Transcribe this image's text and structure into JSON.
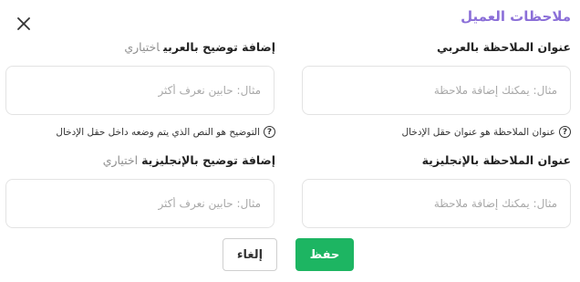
{
  "dialog": {
    "title": "ملاحظات العميل",
    "close_icon": "close-icon"
  },
  "fields": {
    "arabic_title": {
      "label": "عنوان الملاحظة بالعربي",
      "placeholder": "مثال: يمكنك إضافة ملاحظة",
      "value": ""
    },
    "arabic_description": {
      "label": "إضافة توضيح بالعربي",
      "optional": "اختياري",
      "placeholder": "مثال: حابين نعرف أكثر",
      "value": ""
    },
    "english_title": {
      "label": "عنوان الملاحظة بالإنجليزية",
      "placeholder": "مثال: يمكنك إضافة ملاحظة",
      "value": ""
    },
    "english_description": {
      "label": "إضافة توضيح بالإنجليزية",
      "optional": "اختياري",
      "placeholder": "مثال: حابين نعرف أكثر",
      "value": ""
    }
  },
  "hints": {
    "title_hint": "عنوان الملاحظة هو عنوان حقل الإدخال",
    "description_hint": "التوضيح هو النص الذي يتم وضعه داخل حقل الإدخال",
    "hint_icon_symbol": "?",
    "hint_icon": "question-circle-icon"
  },
  "actions": {
    "save_label": "حفظ",
    "cancel_label": "إلغاء"
  },
  "colors": {
    "title": "#8b6fd8",
    "save_button": "#1db562",
    "border": "#e3e3e3"
  }
}
